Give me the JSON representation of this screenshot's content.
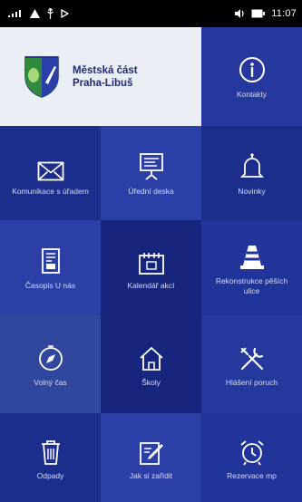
{
  "status_bar": {
    "time": "11:07",
    "left_icons": [
      "signal-icon",
      "warning-icon",
      "usb-icon",
      "cast-icon"
    ],
    "right_icons": [
      "volume-icon",
      "battery-icon"
    ]
  },
  "header": {
    "title_line1": "Městská část",
    "title_line2": "Praha-Libuš"
  },
  "tiles": [
    {
      "label": "Kontakty",
      "icon": "info-icon"
    },
    {
      "label": "Komunikace s úřadem",
      "icon": "envelope-icon"
    },
    {
      "label": "Úřední deska",
      "icon": "presentation-board-icon"
    },
    {
      "label": "Novinky",
      "icon": "bell-icon"
    },
    {
      "label": "Časopis U nás",
      "icon": "magazine-icon"
    },
    {
      "label": "Kalendář akcí",
      "icon": "calendar-icon"
    },
    {
      "label": "Rekonstrukce pěších ulice",
      "icon": "traffic-cone-icon"
    },
    {
      "label": "Volný čas",
      "icon": "compass-icon"
    },
    {
      "label": "Školy",
      "icon": "house-icon"
    },
    {
      "label": "Hlášení poruch",
      "icon": "tools-icon"
    },
    {
      "label": "Odpady",
      "icon": "trash-icon"
    },
    {
      "label": "Jak si zařídit",
      "icon": "pen-paper-icon"
    },
    {
      "label": "Rezervace mp",
      "icon": "alarm-clock-icon"
    }
  ],
  "colors": {
    "background": "#0f1f6e",
    "logo_tile": "#eceef5",
    "logo_text": "#1e2a7a",
    "tile_label": "#d8def6"
  }
}
